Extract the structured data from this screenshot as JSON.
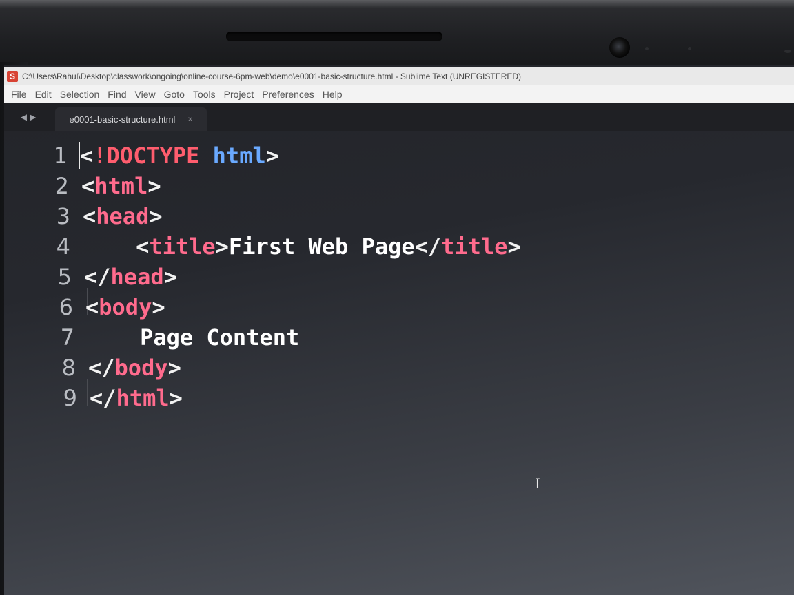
{
  "window": {
    "title": "C:\\Users\\Rahul\\Desktop\\classwork\\ongoing\\online-course-6pm-web\\demo\\e0001-basic-structure.html - Sublime Text (UNREGISTERED)",
    "app_icon": "sublime-text-icon"
  },
  "menu": [
    "File",
    "Edit",
    "Selection",
    "Find",
    "View",
    "Goto",
    "Tools",
    "Project",
    "Preferences",
    "Help"
  ],
  "tabs": [
    {
      "label": "e0001-basic-structure.html",
      "close": "×"
    }
  ],
  "nav": {
    "back": "◀",
    "forward": "▶"
  },
  "editor": {
    "lines": [
      {
        "num": "1",
        "tokens": [
          {
            "t": "<",
            "c": "punct"
          },
          {
            "t": "!DOCTYPE",
            "c": "kw"
          },
          {
            "t": " ",
            "c": "text"
          },
          {
            "t": "html",
            "c": "typ"
          },
          {
            "t": ">",
            "c": "punct"
          }
        ]
      },
      {
        "num": "2",
        "tokens": [
          {
            "t": "<",
            "c": "punct"
          },
          {
            "t": "html",
            "c": "tag"
          },
          {
            "t": ">",
            "c": "punct"
          }
        ]
      },
      {
        "num": "3",
        "tokens": [
          {
            "t": "<",
            "c": "punct"
          },
          {
            "t": "head",
            "c": "tag"
          },
          {
            "t": ">",
            "c": "punct"
          }
        ]
      },
      {
        "num": "4",
        "tokens": [
          {
            "t": "    <",
            "c": "punct"
          },
          {
            "t": "title",
            "c": "tag"
          },
          {
            "t": ">",
            "c": "punct"
          },
          {
            "t": "First Web Page",
            "c": "text"
          },
          {
            "t": "</",
            "c": "punct"
          },
          {
            "t": "title",
            "c": "tag"
          },
          {
            "t": ">",
            "c": "punct"
          }
        ]
      },
      {
        "num": "5",
        "tokens": [
          {
            "t": "</",
            "c": "punct"
          },
          {
            "t": "head",
            "c": "tag"
          },
          {
            "t": ">",
            "c": "punct"
          }
        ]
      },
      {
        "num": "6",
        "tokens": [
          {
            "t": "<",
            "c": "punct"
          },
          {
            "t": "body",
            "c": "tag"
          },
          {
            "t": ">",
            "c": "punct"
          }
        ]
      },
      {
        "num": "7",
        "tokens": [
          {
            "t": "    Page Content",
            "c": "text"
          }
        ]
      },
      {
        "num": "8",
        "tokens": [
          {
            "t": "</",
            "c": "punct"
          },
          {
            "t": "body",
            "c": "tag"
          },
          {
            "t": ">",
            "c": "punct"
          }
        ]
      },
      {
        "num": "9",
        "tokens": [
          {
            "t": "</",
            "c": "punct"
          },
          {
            "t": "html",
            "c": "tag"
          },
          {
            "t": ">",
            "c": "punct"
          }
        ]
      }
    ],
    "mouse_cursor": "I"
  }
}
